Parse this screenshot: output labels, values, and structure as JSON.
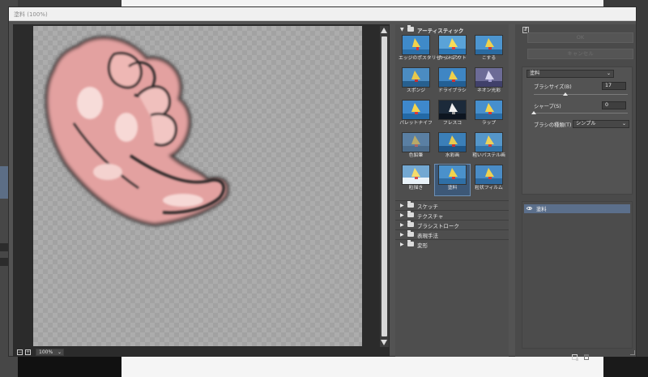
{
  "window": {
    "title": "塗料 (100%)"
  },
  "preview": {
    "zoom": "100%",
    "zoom_out_label": "−",
    "zoom_in_label": "+"
  },
  "gallery": {
    "open_category": "アーティスティック",
    "filters": [
      {
        "label": "エッジのポスタリゼーション"
      },
      {
        "label": "カットアウト"
      },
      {
        "label": "こする"
      },
      {
        "label": "スポンジ"
      },
      {
        "label": "ドライブラシ"
      },
      {
        "label": "ネオン光彩"
      },
      {
        "label": "パレットナイフ"
      },
      {
        "label": "フレスコ"
      },
      {
        "label": "ラップ"
      },
      {
        "label": "色鉛筆"
      },
      {
        "label": "水彩画"
      },
      {
        "label": "粗いパステル画"
      },
      {
        "label": "粒描き"
      },
      {
        "label": "塗料"
      },
      {
        "label": "粒状フィルム"
      }
    ],
    "selected_filter": "塗料",
    "categories": [
      {
        "label": "スケッチ"
      },
      {
        "label": "テクスチャ"
      },
      {
        "label": "ブラシストローク"
      },
      {
        "label": "表現手法"
      },
      {
        "label": "変形"
      }
    ]
  },
  "controls": {
    "ok_label": "OK",
    "cancel_label": "キャンセル",
    "filter_select": "塗料",
    "brush_size_label": "ブラシサイズ(B)",
    "brush_size_value": "17",
    "brush_size_fraction": 0.34,
    "sharpness_label": "シャープ(S)",
    "sharpness_value": "0",
    "sharpness_fraction": 0.0,
    "brush_type_label": "ブラシの種類(T) :",
    "brush_type_value": "シンプル"
  },
  "layers": [
    {
      "name": "塗料"
    }
  ],
  "colors": {
    "accent_selected": "#3d5877",
    "layer_highlight": "#5b6f8b"
  }
}
